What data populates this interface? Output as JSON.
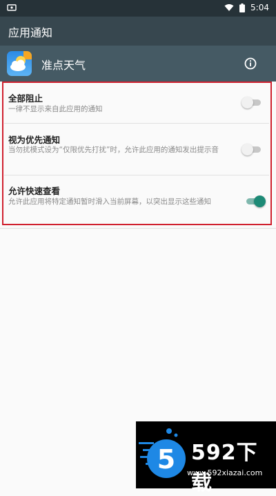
{
  "status_bar": {
    "time": "5:04"
  },
  "app_bar": {
    "title": "应用通知"
  },
  "app": {
    "name": "准点天气",
    "icon": "weather-app-icon"
  },
  "settings": [
    {
      "title": "全部阻止",
      "description": "一律不显示来自此应用的通知",
      "enabled": false
    },
    {
      "title": "视为优先通知",
      "description": "当勿扰模式设为“仅限优先打扰”时，允许此应用的通知发出提示音",
      "enabled": false
    },
    {
      "title": "允许快速查看",
      "description": "允许此应用将特定通知暂时滑入当前屏幕，以突出显示这些通知",
      "enabled": true
    }
  ],
  "watermark": {
    "brand": "592下载",
    "url": "www.592xiazai.com"
  },
  "colors": {
    "status_bar": "#263238",
    "app_bar": "#37474f",
    "app_row": "#455a64",
    "accent": "#1d8a76",
    "highlight": "#d0202e"
  }
}
